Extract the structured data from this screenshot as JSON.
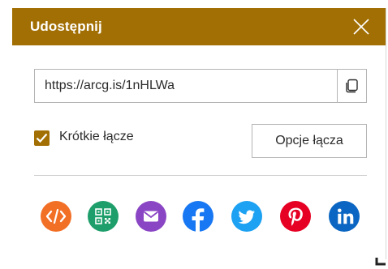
{
  "dialog": {
    "title": "Udostępnij",
    "close_icon": "close-icon",
    "url": "https://arcg.is/1nHLWa",
    "copy_icon": "copy-icon",
    "short_link": {
      "checked": true,
      "label": "Krótkie łącze"
    },
    "options_button": "Opcje łącza",
    "share_buttons": [
      {
        "icon": "embed-icon",
        "color": "#f26f26"
      },
      {
        "icon": "qr-code-icon",
        "color": "#1e9e6a"
      },
      {
        "icon": "email-icon",
        "color": "#8a45c4"
      },
      {
        "icon": "facebook-icon",
        "color": "#1877f2"
      },
      {
        "icon": "twitter-icon",
        "color": "#1da1f2"
      },
      {
        "icon": "pinterest-icon",
        "color": "#e60023"
      },
      {
        "icon": "linkedin-icon",
        "color": "#0a66c2"
      }
    ]
  },
  "colors": {
    "accent": "#a26f04",
    "border": "#b5b5b5",
    "text": "#2b2b2b"
  }
}
